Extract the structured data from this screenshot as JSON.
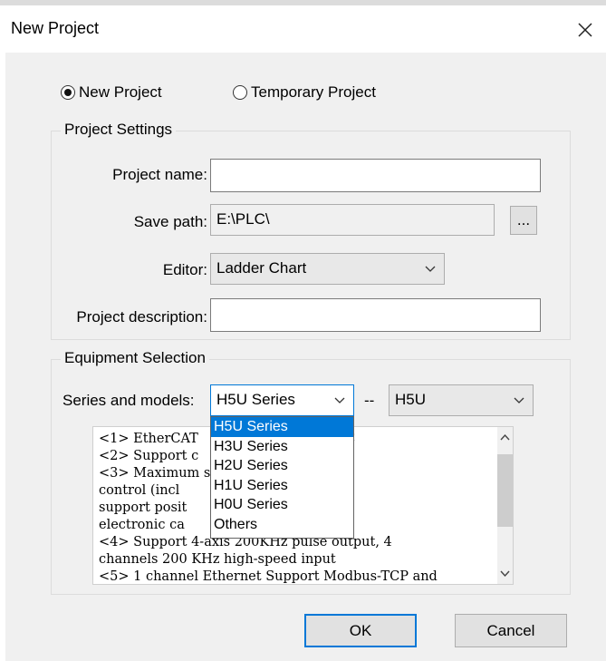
{
  "window": {
    "title": "New Project"
  },
  "mode": {
    "new_project": "New Project",
    "temporary_project": "Temporary Project"
  },
  "project_settings": {
    "legend": "Project Settings",
    "name_label": "Project name:",
    "name_value": "",
    "path_label": "Save path:",
    "path_value": "E:\\PLC\\",
    "browse_label": "...",
    "editor_label": "Editor:",
    "editor_value": "Ladder Chart",
    "desc_label": "Project description:",
    "desc_value": ""
  },
  "equipment": {
    "legend": "Equipment Selection",
    "series_label": "Series and models:",
    "series_value": "H5U Series",
    "separator": "--",
    "model_value": "H5U",
    "series_options": [
      "H5U Series",
      "H3U Series",
      "H2U Series",
      "H1U Series",
      "H0U Series",
      "Others"
    ],
    "description_text": "<1> EtherCAT             ance small PLC\n<2> Support c            and FB/FC\n<3> Maximum s             is motion\ncontrol (incl              nd local pulse),\nsupport posit             ation and\nelectronic ca\n<4> Support 4-axis 200KHz pulse output, 4\nchannels 200 KHz high-speed input\n<5> 1 channel Ethernet Support Modbus-TCP and"
  },
  "buttons": {
    "ok": "OK",
    "cancel": "Cancel"
  }
}
